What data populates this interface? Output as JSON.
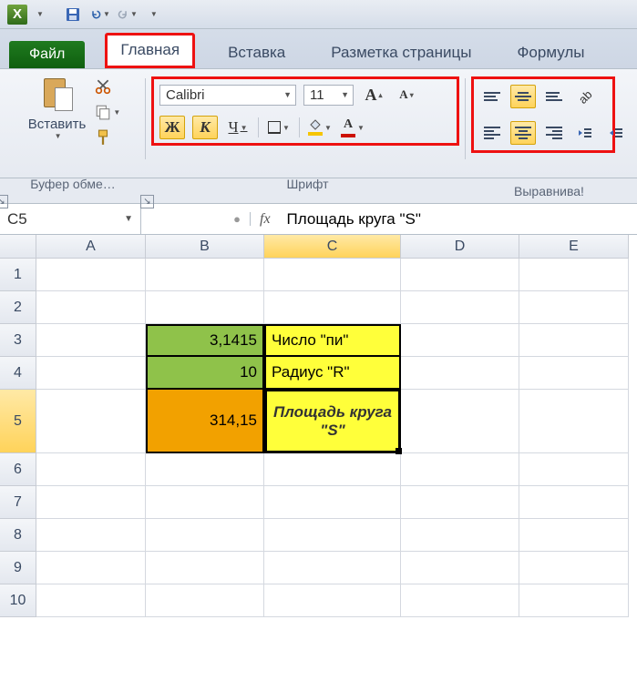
{
  "qat": {
    "save_title": "Сохранить",
    "undo_title": "Отменить",
    "redo_title": "Вернуть"
  },
  "tabs": {
    "file": "Файл",
    "home": "Главная",
    "insert": "Вставка",
    "pagelayout": "Разметка страницы",
    "formulas": "Формулы"
  },
  "ribbon": {
    "paste_label": "Вставить",
    "font_name": "Calibri",
    "font_size": "11",
    "bold": "Ж",
    "italic": "К",
    "underline": "Ч",
    "bigA": "A",
    "fontColorA": "A"
  },
  "group_labels": {
    "clipboard": "Буфер обме…",
    "font": "Шрифт",
    "alignment": "Выравнива!"
  },
  "namebox": "C5",
  "formula": "Площадь круга \"S\"",
  "fx_label": "fx",
  "columns": [
    "A",
    "B",
    "C",
    "D",
    "E"
  ],
  "rows": [
    "1",
    "2",
    "3",
    "4",
    "5",
    "6",
    "7",
    "8",
    "9",
    "10"
  ],
  "cells": {
    "B3": "3,1415",
    "C3": "Число \"пи\"",
    "B4": "10",
    "C4": "Радиус \"R\"",
    "B5": "314,15",
    "C5": "Площадь круга \"S\""
  }
}
